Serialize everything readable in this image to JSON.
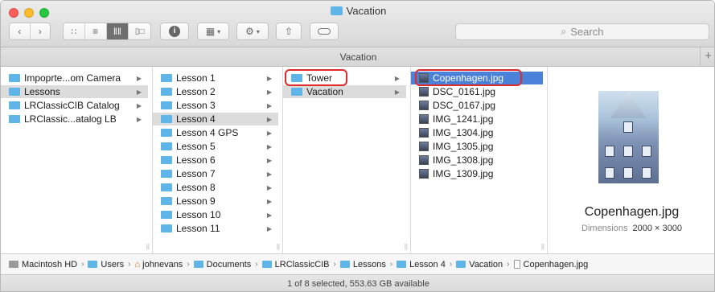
{
  "window": {
    "title": "Vacation"
  },
  "toolbar": {
    "back_icon": "chevron-left-icon",
    "forward_icon": "chevron-right-icon",
    "view_icons": [
      "icon-view-icon",
      "list-view-icon",
      "column-view-icon",
      "cover-flow-icon"
    ],
    "active_view": "column",
    "info_icon": "info-icon",
    "arrange_icon": "arrange-icon",
    "action_icon": "gear-icon",
    "share_icon": "share-icon",
    "tag_icon": "tag-icon"
  },
  "search": {
    "placeholder": "Search"
  },
  "path_header": {
    "label": "Vacation"
  },
  "columns": [
    {
      "items": [
        {
          "label": "Impoprte...om Camera",
          "has_children": true,
          "state": ""
        },
        {
          "label": "Lessons",
          "has_children": true,
          "state": "gray"
        },
        {
          "label": "LRClassicCIB Catalog",
          "has_children": true,
          "state": ""
        },
        {
          "label": "LRClassic...atalog LB",
          "has_children": true,
          "state": ""
        }
      ]
    },
    {
      "items": [
        {
          "label": "Lesson 1",
          "has_children": true,
          "state": ""
        },
        {
          "label": "Lesson 2",
          "has_children": true,
          "state": ""
        },
        {
          "label": "Lesson 3",
          "has_children": true,
          "state": ""
        },
        {
          "label": "Lesson 4",
          "has_children": true,
          "state": "gray"
        },
        {
          "label": "Lesson 4 GPS",
          "has_children": true,
          "state": ""
        },
        {
          "label": "Lesson 5",
          "has_children": true,
          "state": ""
        },
        {
          "label": "Lesson 6",
          "has_children": true,
          "state": ""
        },
        {
          "label": "Lesson 7",
          "has_children": true,
          "state": ""
        },
        {
          "label": "Lesson 8",
          "has_children": true,
          "state": ""
        },
        {
          "label": "Lesson 9",
          "has_children": true,
          "state": ""
        },
        {
          "label": "Lesson 10",
          "has_children": true,
          "state": ""
        },
        {
          "label": "Lesson 11",
          "has_children": true,
          "state": ""
        }
      ]
    },
    {
      "items": [
        {
          "label": "Tower",
          "has_children": true,
          "state": ""
        },
        {
          "label": "Vacation",
          "has_children": true,
          "state": "gray"
        }
      ]
    },
    {
      "items": [
        {
          "label": "Copenhagen.jpg",
          "state": "blue"
        },
        {
          "label": "DSC_0161.jpg",
          "state": ""
        },
        {
          "label": "DSC_0167.jpg",
          "state": ""
        },
        {
          "label": "IMG_1241.jpg",
          "state": ""
        },
        {
          "label": "IMG_1304.jpg",
          "state": ""
        },
        {
          "label": "IMG_1305.jpg",
          "state": ""
        },
        {
          "label": "IMG_1308.jpg",
          "state": ""
        },
        {
          "label": "IMG_1309.jpg",
          "state": ""
        }
      ]
    }
  ],
  "preview": {
    "file_name": "Copenhagen.jpg",
    "dimensions_label": "Dimensions",
    "dimensions_value": "2000 × 3000"
  },
  "breadcrumbs": [
    {
      "label": "Macintosh HD",
      "icon": "hard-drive-icon"
    },
    {
      "label": "Users",
      "icon": "folder-icon"
    },
    {
      "label": "johnevans",
      "icon": "home-icon"
    },
    {
      "label": "Documents",
      "icon": "folder-icon"
    },
    {
      "label": "LRClassicCIB",
      "icon": "folder-icon"
    },
    {
      "label": "Lessons",
      "icon": "folder-icon"
    },
    {
      "label": "Lesson 4",
      "icon": "folder-icon"
    },
    {
      "label": "Vacation",
      "icon": "folder-icon"
    },
    {
      "label": "Copenhagen.jpg",
      "icon": "file-icon"
    }
  ],
  "status": {
    "text": "1 of 8 selected, 553.63 GB available"
  },
  "colors": {
    "selection_blue": "#4a81d9",
    "selection_gray": "#dcdcdc",
    "folder_blue": "#5fb4e8",
    "highlight_red": "#e12a2a"
  }
}
